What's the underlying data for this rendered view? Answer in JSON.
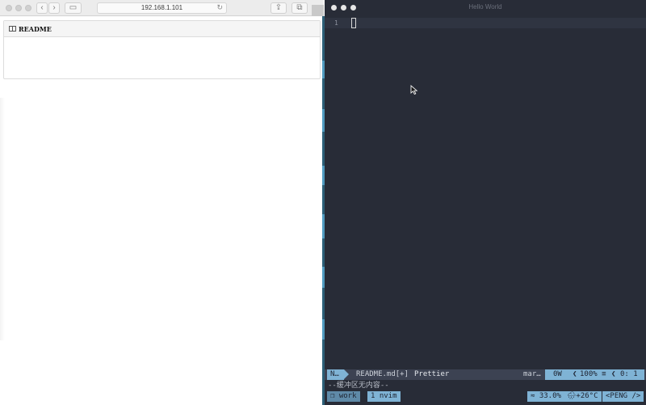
{
  "browser": {
    "address": "192.168.1.101",
    "readme_title": "README"
  },
  "terminal": {
    "window_title": "Hello World",
    "line_number": "1",
    "statusline": {
      "mode": "N…",
      "filename": "README.md[+]",
      "formatter": "Prettier",
      "filetype": "mar…",
      "warnings": "0W",
      "percent": "100% ≡",
      "position": "0:  1"
    },
    "cmdline": "--缓冲区无内容--",
    "tmux": {
      "session": "❐ work",
      "window": "1 nvim",
      "cpu": "≈ 33.0%",
      "weather": "🌧+26°C",
      "user": "<PENG />"
    }
  }
}
